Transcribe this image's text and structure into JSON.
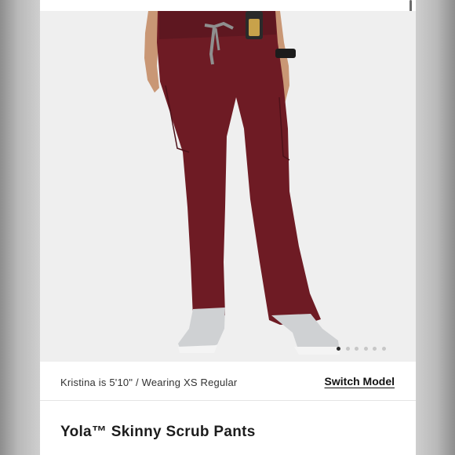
{
  "model": {
    "info": "Kristina is 5'10\" / Wearing XS Regular",
    "switch_label": "Switch Model"
  },
  "product": {
    "title": "Yola™ Skinny Scrub Pants",
    "color": "#6e1b24"
  },
  "gallery": {
    "image_count": 6,
    "active_index": 0
  }
}
